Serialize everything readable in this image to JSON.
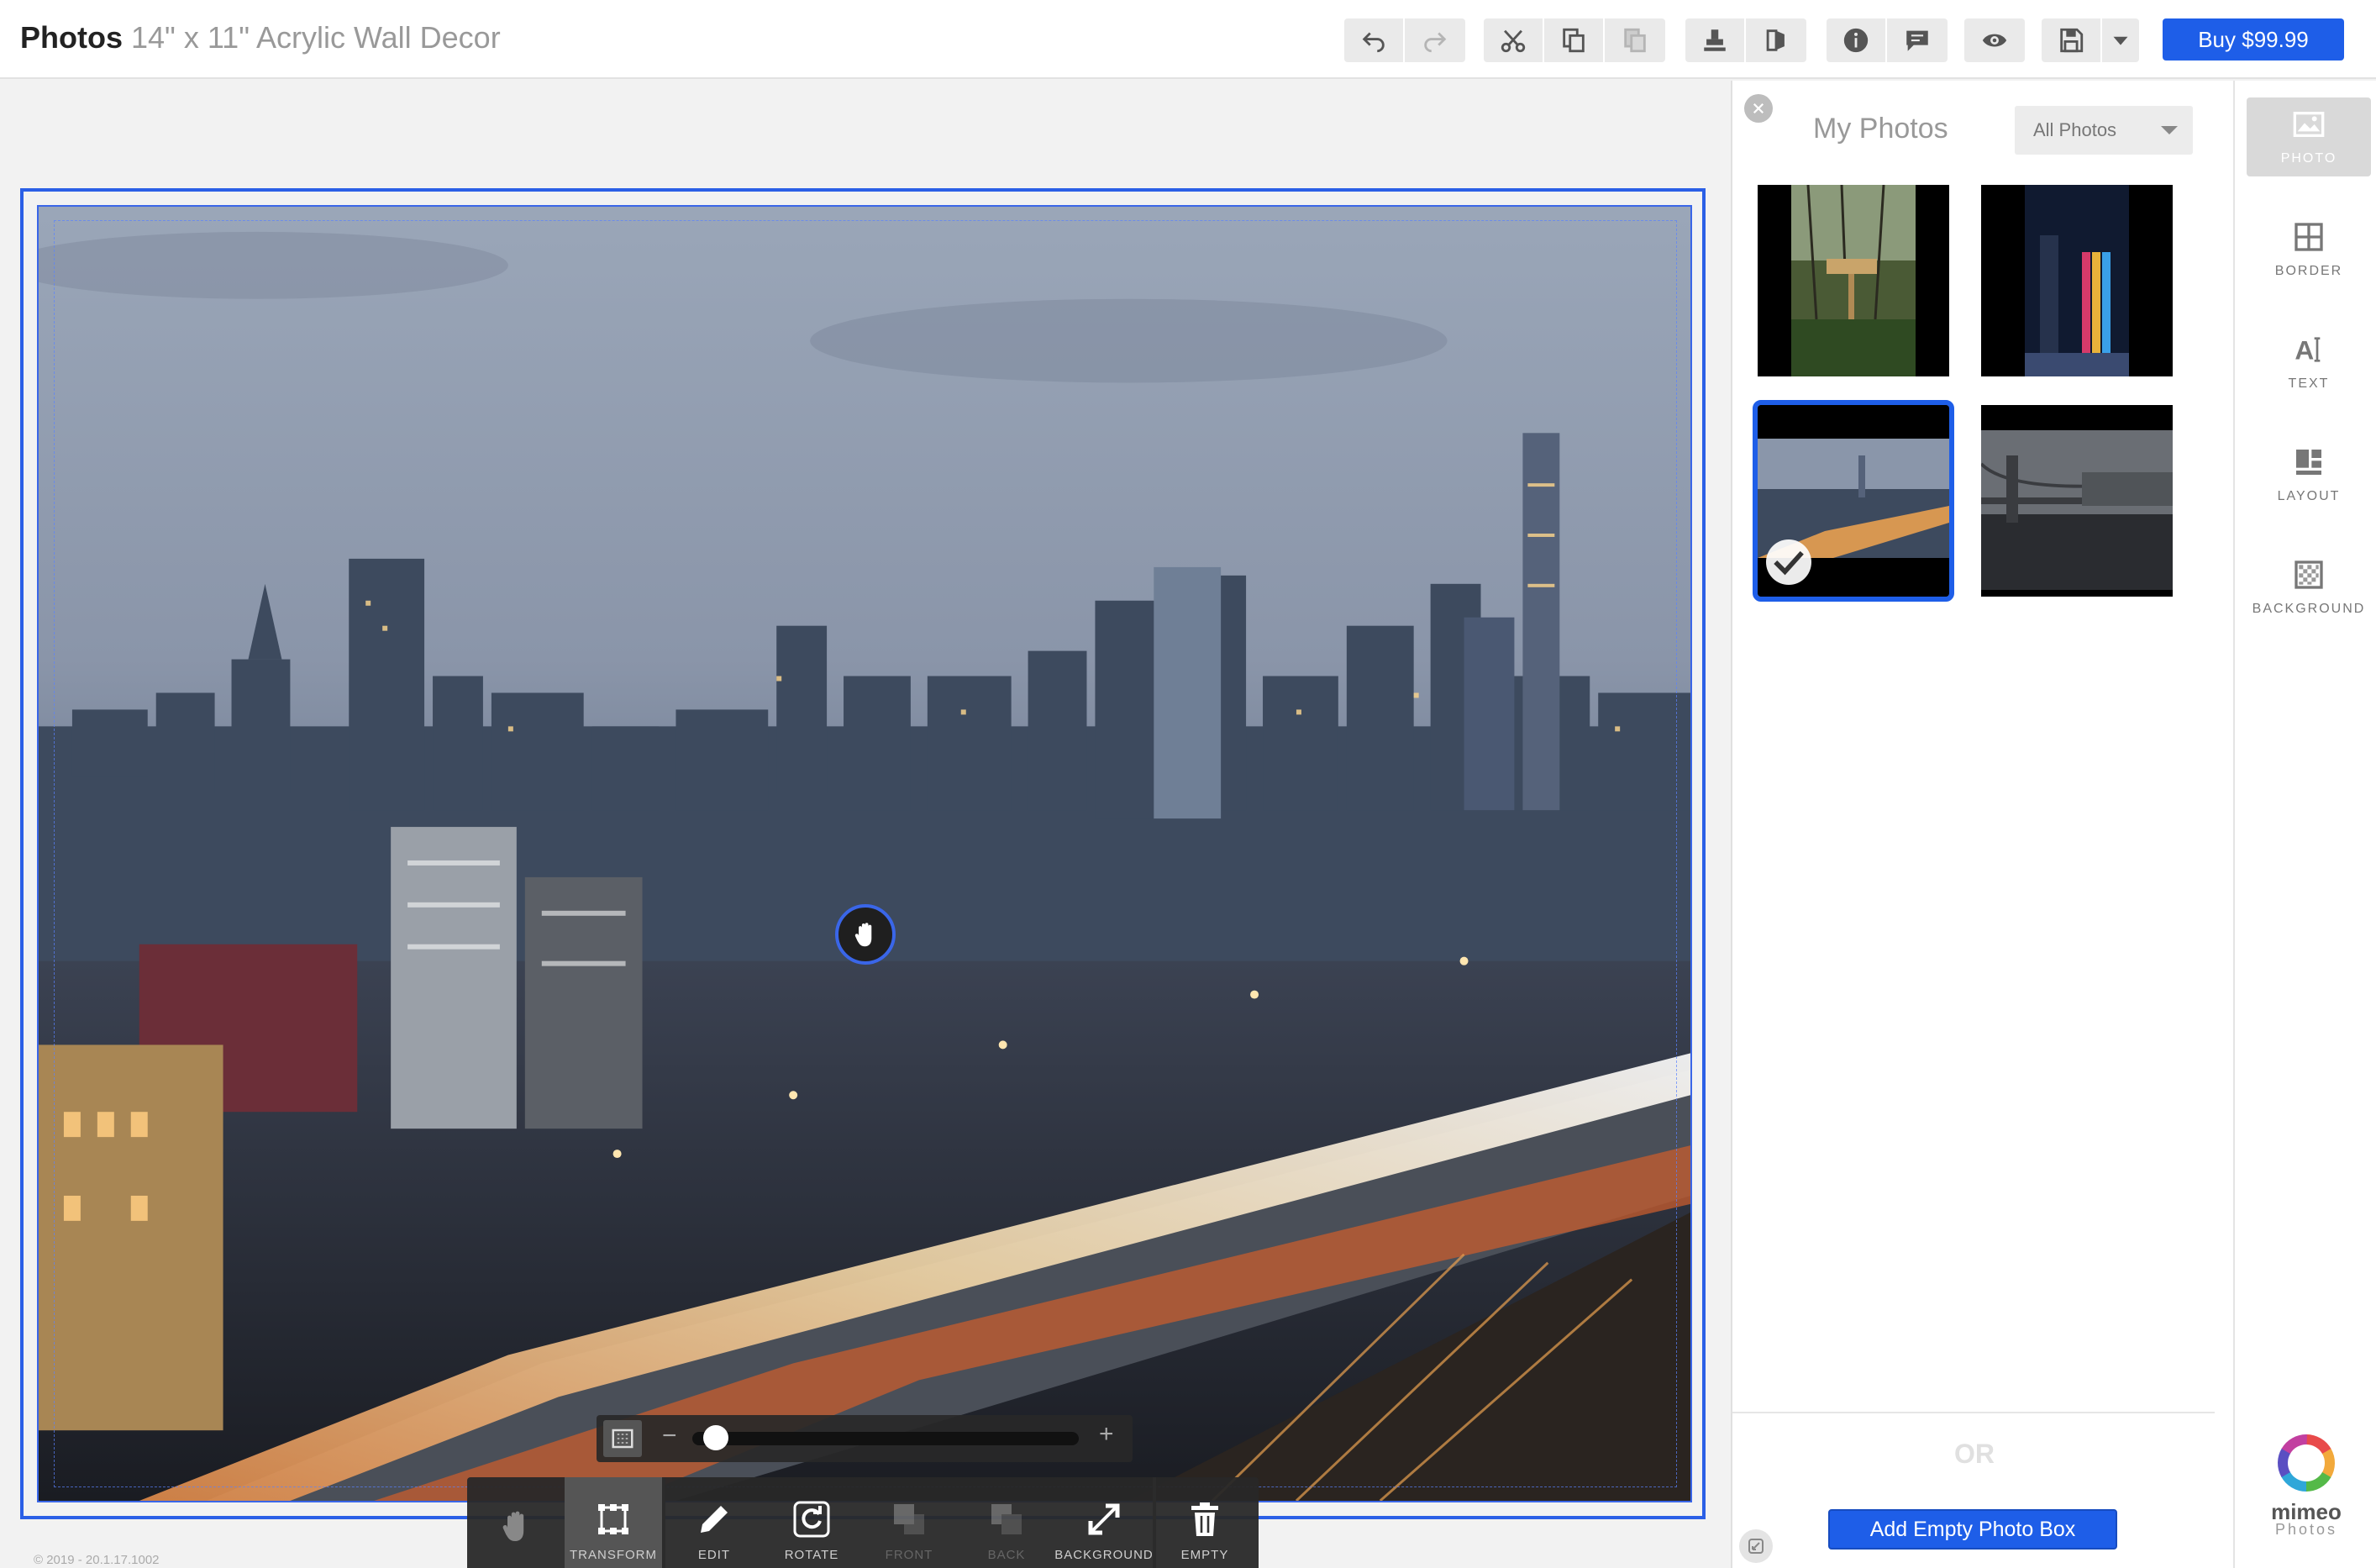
{
  "header": {
    "app_title": "Photos",
    "product_title": "14\" x 11\" Acrylic Wall Decor",
    "buy_label": "Buy $99.99",
    "toolbar_icons": [
      "undo-icon",
      "redo-icon",
      "cut-icon",
      "copy-icon",
      "paste-icon",
      "stamp-icon",
      "mirror-icon",
      "info-icon",
      "comment-icon",
      "preview-icon",
      "save-icon",
      "dropdown-icon"
    ]
  },
  "canvas": {
    "zoom": {
      "minus": "−",
      "plus": "+",
      "level": 0.03
    },
    "tools": [
      {
        "label": "",
        "icon": "hand-icon",
        "enabled": true
      },
      {
        "label": "TRANSFORM",
        "icon": "transform-icon",
        "enabled": true
      },
      {
        "label": "EDIT",
        "icon": "pencil-icon",
        "enabled": true
      },
      {
        "label": "ROTATE",
        "icon": "rotate-icon",
        "enabled": true
      },
      {
        "label": "FRONT",
        "icon": "bring-front-icon",
        "enabled": false
      },
      {
        "label": "BACK",
        "icon": "send-back-icon",
        "enabled": false
      },
      {
        "label": "BACKGROUND",
        "icon": "expand-icon",
        "enabled": true
      },
      {
        "label": "EMPTY",
        "icon": "trash-icon",
        "enabled": true
      }
    ],
    "copyright": "© 2019 - 20.1.17.1002"
  },
  "photos_panel": {
    "title": "My Photos",
    "filter_value": "All Photos",
    "thumbnails": [
      {
        "name": "waterfall-sign-photo",
        "selected": false
      },
      {
        "name": "city-lights-photo",
        "selected": false
      },
      {
        "name": "skyline-highway-photo",
        "selected": true
      },
      {
        "name": "bridge-photo",
        "selected": false
      }
    ],
    "or_label": "OR",
    "add_button": "Add Empty Photo Box"
  },
  "right_rail": {
    "items": [
      {
        "label": "PHOTO",
        "icon": "photo-icon",
        "active": true
      },
      {
        "label": "BORDER",
        "icon": "border-icon",
        "active": false
      },
      {
        "label": "TEXT",
        "icon": "text-icon",
        "active": false
      },
      {
        "label": "LAYOUT",
        "icon": "layout-icon",
        "active": false
      },
      {
        "label": "BACKGROUND",
        "icon": "background-icon",
        "active": false
      }
    ],
    "brand_name": "mimeo",
    "brand_sub": "Photos"
  },
  "colors": {
    "accent": "#1e5ee8",
    "toolbar_bg": "#282828"
  }
}
